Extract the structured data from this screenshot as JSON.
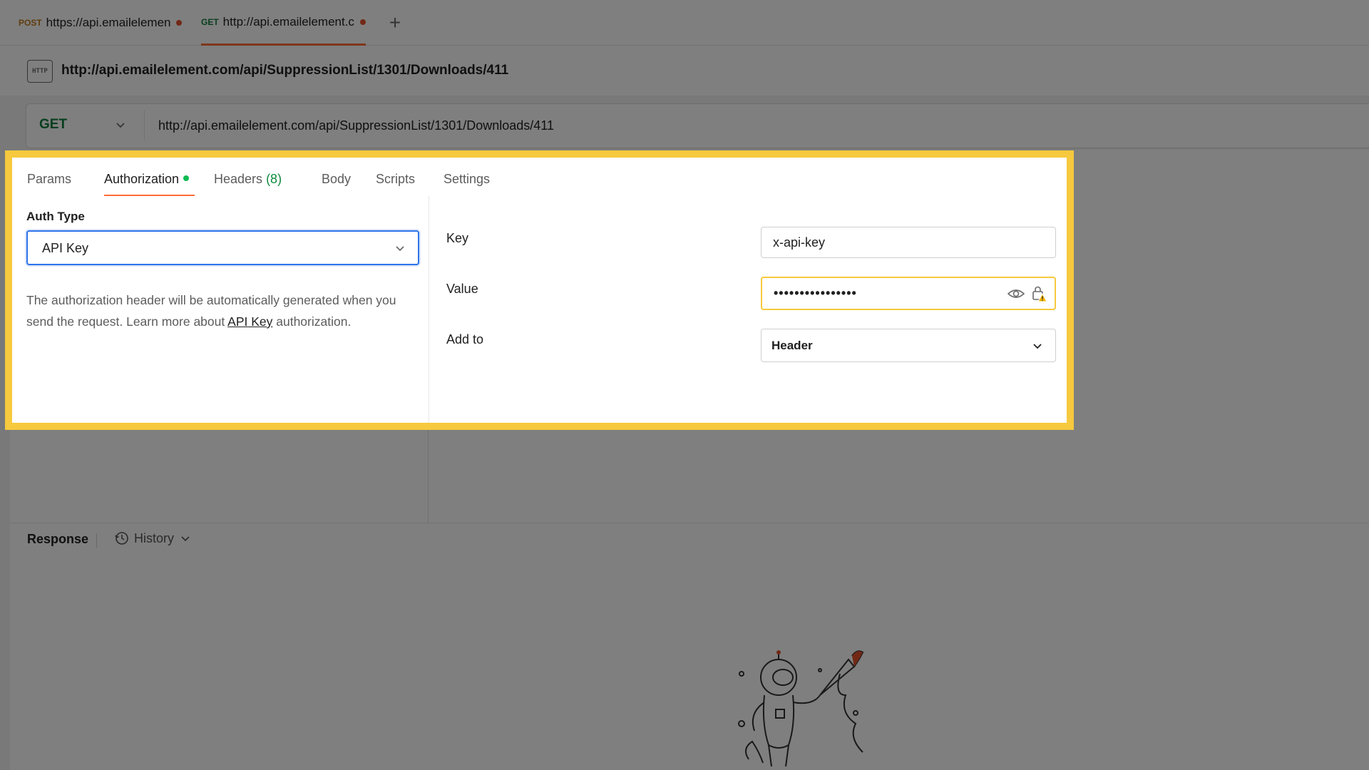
{
  "tabs": [
    {
      "method": "POST",
      "url": "https://api.emailelement.com",
      "unsaved": true,
      "active": false
    },
    {
      "method": "GET",
      "url": "http://api.emailelement.com/api",
      "unsaved": true,
      "active": true
    }
  ],
  "add_tab_symbol": "+",
  "request": {
    "protocol_icon": "HTTP",
    "title": "http://api.emailelement.com/api/SuppressionList/1301/Downloads/411",
    "method": "GET",
    "url": "http://api.emailelement.com/api/SuppressionList/1301/Downloads/411"
  },
  "request_tabs": [
    {
      "label": "Params"
    },
    {
      "label": "Authorization",
      "active": true,
      "indicator": "green-dot"
    },
    {
      "label": "Headers",
      "count": "(8)"
    },
    {
      "label": "Body"
    },
    {
      "label": "Scripts"
    },
    {
      "label": "Settings"
    }
  ],
  "auth": {
    "type_label": "Auth Type",
    "type_value": "API Key",
    "description_before": "The authorization header will be automatically generated when you send the request. Learn more about ",
    "description_link": "API Key",
    "description_after": " authorization.",
    "fields": {
      "key_label": "Key",
      "key_value": "x-api-key",
      "value_label": "Value",
      "value_masked": "••••••••••••••••",
      "add_to_label": "Add to",
      "add_to_value": "Header"
    }
  },
  "response": {
    "label": "Response",
    "history_label": "History"
  },
  "icons": {
    "value_reveal": "eye-icon",
    "value_lock_warning": "lock-warning-icon",
    "history": "clock-history-icon",
    "empty_state": "astronaut-rocket-illustration"
  },
  "colors": {
    "highlight_border": "#f6c93e",
    "active_tab_underline": "#ff6c37",
    "get_method": "#0f7c3c",
    "auth_active_dot": "#0cbb52",
    "unsaved_dot": "#e5532d",
    "focus_border": "#2e73e8"
  }
}
